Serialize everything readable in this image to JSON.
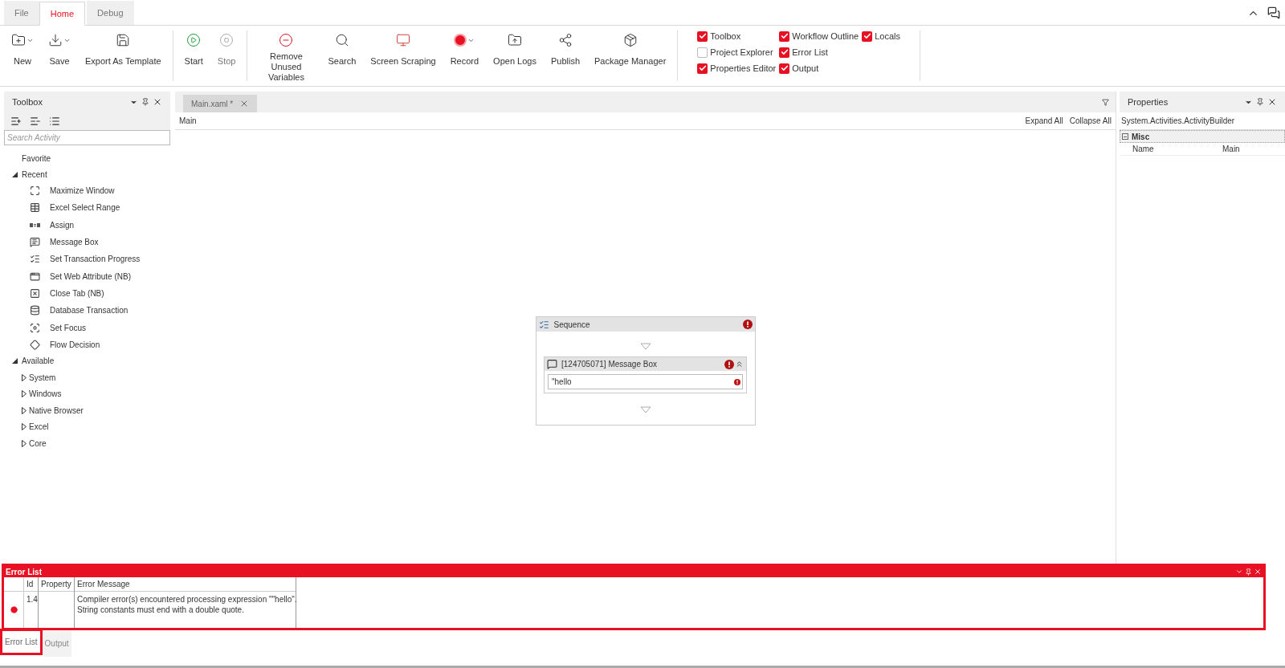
{
  "ribbon_tabs": [
    {
      "label": "File",
      "selected": false
    },
    {
      "label": "Home",
      "selected": true
    },
    {
      "label": "Debug",
      "selected": false
    }
  ],
  "ribbon_groups": [
    {
      "buttons": [
        {
          "label": "New",
          "dropdown": true,
          "disabled": false
        },
        {
          "label": "Save",
          "dropdown": true,
          "disabled": false
        },
        {
          "label": "Export As Template",
          "dropdown": false,
          "disabled": false
        }
      ]
    },
    {
      "buttons": [
        {
          "label": "Start",
          "dropdown": false,
          "disabled": false
        },
        {
          "label": "Stop",
          "dropdown": false,
          "disabled": true
        }
      ]
    },
    {
      "buttons": [
        {
          "label": "Remove Unused Variables",
          "dropdown": false,
          "disabled": false
        },
        {
          "label": "Search",
          "dropdown": false,
          "disabled": false
        },
        {
          "label": "Screen Scraping",
          "dropdown": false,
          "disabled": false
        },
        {
          "label": "Record",
          "dropdown": true,
          "disabled": false
        },
        {
          "label": "Open Logs",
          "dropdown": false,
          "disabled": false
        },
        {
          "label": "Publish",
          "dropdown": false,
          "disabled": false
        },
        {
          "label": "Package Manager",
          "dropdown": false,
          "disabled": false
        }
      ]
    }
  ],
  "panel_toggles": [
    [
      {
        "label": "Toolbox",
        "checked": true
      },
      {
        "label": "Project Explorer",
        "checked": false
      },
      {
        "label": "Properties Editor",
        "checked": true
      }
    ],
    [
      {
        "label": "Workflow Outline",
        "checked": true
      },
      {
        "label": "Error List",
        "checked": true
      },
      {
        "label": "Output",
        "checked": true
      }
    ],
    [
      {
        "label": "Locals",
        "checked": true
      }
    ]
  ],
  "toolbox": {
    "title": "Toolbox",
    "search": {
      "placeholder": "Search Activity"
    },
    "tree": [
      {
        "label": "Favorite",
        "kind": "leaf"
      },
      {
        "label": "Recent",
        "kind": "folder",
        "expanded": true,
        "children": [
          {
            "label": "Maximize Window",
            "kind": "activity"
          },
          {
            "label": "Excel Select Range",
            "kind": "activity"
          },
          {
            "label": "Assign",
            "kind": "activity"
          },
          {
            "label": "Message Box",
            "kind": "activity"
          },
          {
            "label": "Set Transaction Progress",
            "kind": "activity"
          },
          {
            "label": "Set Web Attribute (NB)",
            "kind": "activity"
          },
          {
            "label": "Close Tab (NB)",
            "kind": "activity"
          },
          {
            "label": "Database Transaction",
            "kind": "activity"
          },
          {
            "label": "Set Focus",
            "kind": "activity"
          },
          {
            "label": "Flow Decision",
            "kind": "activity"
          }
        ]
      },
      {
        "label": "Available",
        "kind": "folder",
        "expanded": true,
        "children": [
          {
            "label": "System",
            "kind": "folder",
            "expanded": false
          },
          {
            "label": "Windows",
            "kind": "folder",
            "expanded": false
          },
          {
            "label": "Native Browser",
            "kind": "folder",
            "expanded": false
          },
          {
            "label": "Excel",
            "kind": "folder",
            "expanded": false
          },
          {
            "label": "Core",
            "kind": "folder",
            "expanded": false
          }
        ]
      }
    ]
  },
  "document_tabs": [
    {
      "label": "Main.xaml *",
      "selected": true
    }
  ],
  "designer": {
    "breadcrumb": "Main",
    "links": [
      "Expand All",
      "Collapse All"
    ],
    "sequence": {
      "title": "Sequence",
      "error": true,
      "activity": {
        "title": "[124705071] Message Box",
        "error": true,
        "value": "\"hello",
        "value_error": true
      }
    }
  },
  "properties": {
    "title": "Properties",
    "type_name": "System.Activities.ActivityBuilder",
    "category": "Misc",
    "rows": [
      {
        "name": "Name",
        "value": "Main"
      }
    ]
  },
  "error_list": {
    "title": "Error List",
    "highlighted": true,
    "columns": [
      "Id",
      "Property",
      "Error Message"
    ],
    "rows": [
      {
        "kind": "error",
        "id": "1.4",
        "property": "",
        "message": "Compiler error(s) encountered processing expression \"\"hello\".\nString constants must end with a double quote."
      }
    ]
  },
  "bottom_tabs": [
    {
      "label": "Error List",
      "selected": true,
      "highlighted": true
    },
    {
      "label": "Output",
      "selected": false,
      "highlighted": false
    }
  ]
}
